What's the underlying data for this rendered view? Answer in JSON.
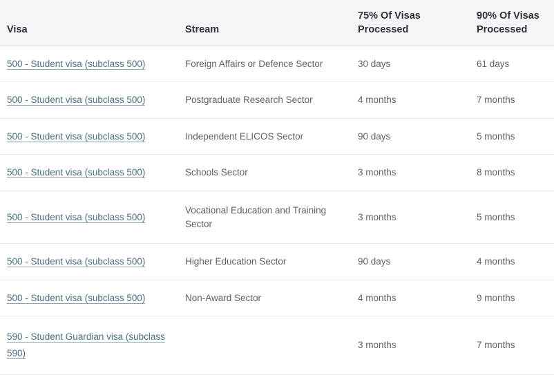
{
  "table": {
    "columns": [
      {
        "key": "visa",
        "label": "Visa"
      },
      {
        "key": "stream",
        "label": "Stream"
      },
      {
        "key": "p75",
        "label": "75% Of Visas Processed"
      },
      {
        "key": "p90",
        "label": "90% Of Visas Processed"
      }
    ],
    "header_labels": {
      "visa": "Visa",
      "stream": "Stream",
      "p75_line1": "75% Of Visas",
      "p75_line2": "Processed",
      "p90_line1": "90% Of Visas",
      "p90_line2": "Processed"
    },
    "rows": [
      {
        "visa": "500 - Student visa (subclass 500)",
        "stream": "Foreign Affairs or Defence Sector",
        "p75": "30 days",
        "p90": "61 days"
      },
      {
        "visa": "500 - Student visa (subclass 500)",
        "stream": "Postgraduate Research Sector",
        "p75": "4 months",
        "p90": "7 months"
      },
      {
        "visa": "500 - Student visa (subclass 500)",
        "stream": "Independent ELICOS Sector",
        "p75": "90 days",
        "p90": "5 months"
      },
      {
        "visa": "500 - Student visa (subclass 500)",
        "stream": "Schools Sector",
        "p75": "3 months",
        "p90": "8 months"
      },
      {
        "visa": "500 - Student visa (subclass 500)",
        "stream": "Vocational Education and Training Sector",
        "p75": "3 months",
        "p90": "5 months"
      },
      {
        "visa": "500 - Student visa (subclass 500)",
        "stream": "Higher Education Sector",
        "p75": "90 days",
        "p90": "4 months"
      },
      {
        "visa": "500 - Student visa (subclass 500)",
        "stream": "Non-Award Sector",
        "p75": "4 months",
        "p90": "9 months"
      },
      {
        "visa": "590 - Student Guardian visa (subclass 590)",
        "stream": "",
        "p75": "3 months",
        "p90": "7 months"
      }
    ]
  },
  "colors": {
    "header_background": "#f4f5f6",
    "header_text": "#2d3338",
    "body_text": "#5d6368",
    "link": "#49707e",
    "row_divider": "#e6e8ea",
    "page_background": "#ffffff"
  }
}
